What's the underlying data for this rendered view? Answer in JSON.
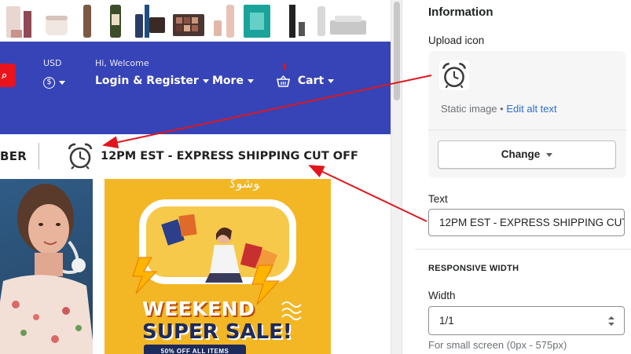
{
  "nav": {
    "currency_label": "USD",
    "currency_symbol": "$",
    "greeting": "Hi, Welcome",
    "login_label": "Login & Register",
    "more_label": "More",
    "cart_label": "Cart"
  },
  "shipping_bar": {
    "prev_text_fragment": "BER",
    "icon": "alarm-clock-icon",
    "text": "12PM EST - EXPRESS SHIPPING CUT OFF"
  },
  "promo": {
    "script_text": "ﻮﺷﻮﻛ",
    "headline_1": "WEEKEND",
    "headline_2": "SUPER SALE!",
    "pill": "50% OFF ALL ITEMS"
  },
  "panel": {
    "section_title": "Information",
    "upload_icon_label": "Upload icon",
    "uploaded_icon": "alarm-clock-icon",
    "static_image": "Static image",
    "separator": " • ",
    "edit_alt_text": "Edit alt text",
    "change_button": "Change",
    "text_label": "Text",
    "text_value": "12PM EST - EXPRESS SHIPPING CUT",
    "responsive_heading": "RESPONSIVE WIDTH",
    "width_label": "Width",
    "width_value": "1/1",
    "small_screen_hint": "For small screen (0px - 575px)"
  },
  "colors": {
    "nav_bg": "#3744b7",
    "accent_red": "#e8131b",
    "promo_bg": "#f3b624",
    "link_blue": "#2c6ecb",
    "annotation_arrow": "#e0161c"
  }
}
